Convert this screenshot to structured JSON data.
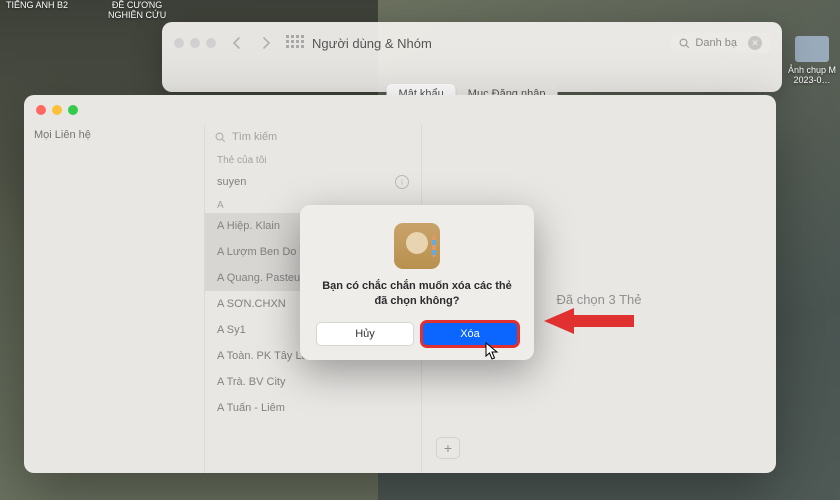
{
  "desktop": {
    "icons": [
      {
        "label": "TIẾNG ANH B2"
      },
      {
        "label": "ĐỀ CƯƠNG\nNGHIÊN CỨU"
      },
      {
        "label": "Ảnh chụp M\n2023-0…"
      }
    ]
  },
  "syswin": {
    "title": "Người dùng & Nhóm",
    "search_placeholder": "Danh bạ",
    "tabs": {
      "password": "Mật khẩu",
      "login_items": "Mục Đăng nhập"
    }
  },
  "contacts": {
    "sidebar": {
      "all": "Mọi Liên hệ"
    },
    "search_placeholder": "Tìm kiếm",
    "section_mycard": "Thẻ của tôi",
    "mycard": "suyen",
    "letter": "A",
    "items": [
      "A Hiệp. Klain",
      "A Lượm Ben Do Tanu",
      "A Quang. Pasteur",
      "A SƠN.CHXN",
      "A Sy1",
      "A Toàn. PK Tây Lân",
      "A Trà. BV City",
      "A Tuấn - Liêm"
    ],
    "detail": {
      "selection_text": "Đã chọn 3 Thẻ"
    }
  },
  "modal": {
    "message": "Bạn có chắc chắn muốn xóa các thẻ đã chọn không?",
    "cancel": "Hủy",
    "confirm": "Xóa"
  }
}
